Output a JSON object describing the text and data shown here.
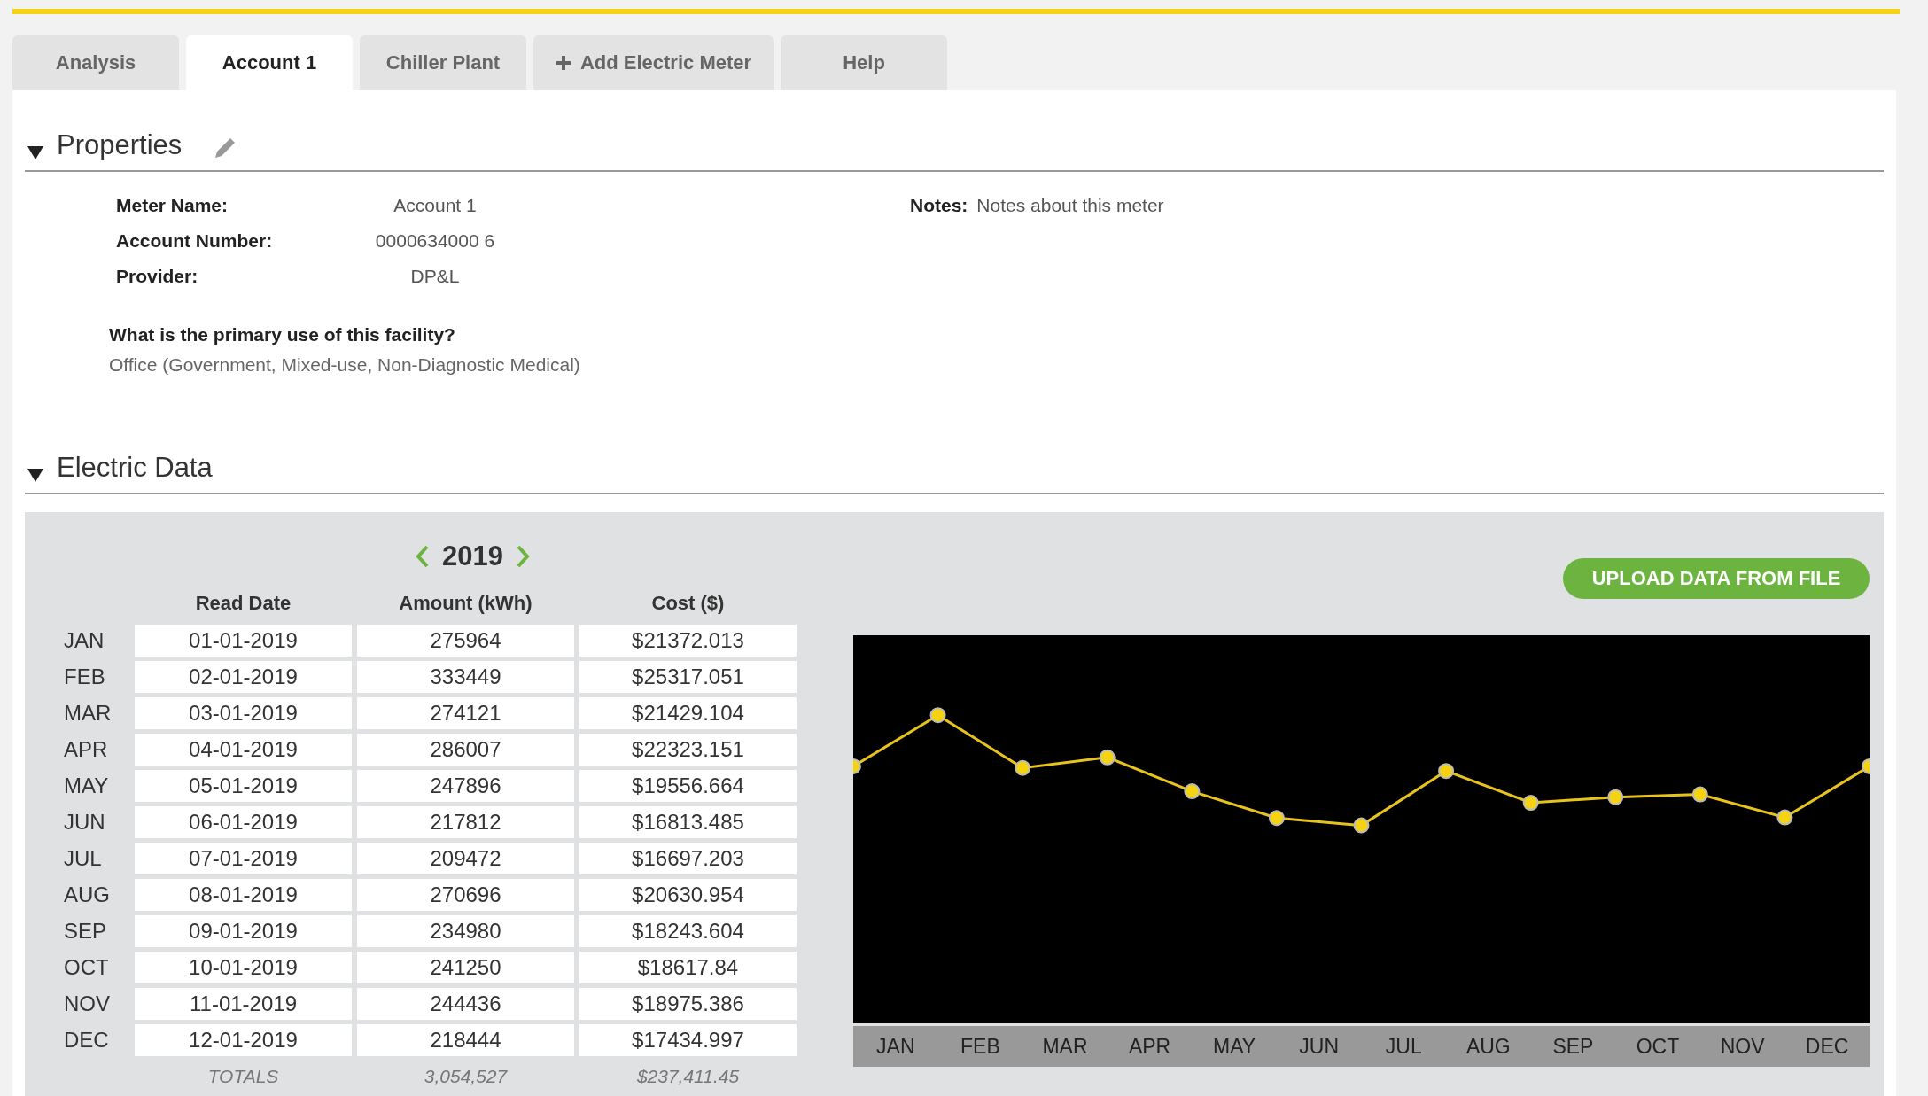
{
  "tabs": [
    {
      "label": "Analysis",
      "selected": false,
      "kind": "tab"
    },
    {
      "label": "Account 1",
      "selected": true,
      "kind": "tab"
    },
    {
      "label": "Chiller Plant",
      "selected": false,
      "kind": "tab"
    },
    {
      "label": "Add Electric Meter",
      "selected": false,
      "kind": "add"
    },
    {
      "label": "Help",
      "selected": false,
      "kind": "tab"
    }
  ],
  "properties": {
    "title": "Properties",
    "expanded": true,
    "fields": [
      {
        "label": "Meter Name:",
        "value": "Account 1"
      },
      {
        "label": "Account Number:",
        "value": "0000634000 6"
      },
      {
        "label": "Provider:",
        "value": "DP&L"
      }
    ],
    "notes": {
      "label": "Notes:",
      "value": "Notes about this meter"
    },
    "question": {
      "label": "What is the primary use of this facility?",
      "value": "Office (Government, Mixed-use, Non-Diagnostic Medical)"
    }
  },
  "electric_data": {
    "title": "Electric Data",
    "expanded": true,
    "year": "2019",
    "upload_button": "UPLOAD DATA FROM FILE",
    "table": {
      "columns": [
        "Read Date",
        "Amount (kWh)",
        "Cost ($)"
      ],
      "rows": [
        {
          "month": "JAN",
          "read_date": "01-01-2019",
          "amount": "275964",
          "cost": "$21372.013"
        },
        {
          "month": "FEB",
          "read_date": "02-01-2019",
          "amount": "333449",
          "cost": "$25317.051"
        },
        {
          "month": "MAR",
          "read_date": "03-01-2019",
          "amount": "274121",
          "cost": "$21429.104"
        },
        {
          "month": "APR",
          "read_date": "04-01-2019",
          "amount": "286007",
          "cost": "$22323.151"
        },
        {
          "month": "MAY",
          "read_date": "05-01-2019",
          "amount": "247896",
          "cost": "$19556.664"
        },
        {
          "month": "JUN",
          "read_date": "06-01-2019",
          "amount": "217812",
          "cost": "$16813.485"
        },
        {
          "month": "JUL",
          "read_date": "07-01-2019",
          "amount": "209472",
          "cost": "$16697.203"
        },
        {
          "month": "AUG",
          "read_date": "08-01-2019",
          "amount": "270696",
          "cost": "$20630.954"
        },
        {
          "month": "SEP",
          "read_date": "09-01-2019",
          "amount": "234980",
          "cost": "$18243.604"
        },
        {
          "month": "OCT",
          "read_date": "10-01-2019",
          "amount": "241250",
          "cost": "$18617.84"
        },
        {
          "month": "NOV",
          "read_date": "11-01-2019",
          "amount": "244436",
          "cost": "$18975.386"
        },
        {
          "month": "DEC",
          "read_date": "12-01-2019",
          "amount": "218444",
          "cost": "$17434.997"
        }
      ],
      "totals": {
        "label": "TOTALS",
        "amount": "3,054,527",
        "cost": "$237,411.45"
      }
    },
    "chart": {
      "x_labels": [
        "JAN",
        "FEB",
        "MAR",
        "APR",
        "MAY",
        "JUN",
        "JUL",
        "AUG",
        "SEP",
        "OCT",
        "NOV",
        "DEC"
      ]
    }
  }
}
